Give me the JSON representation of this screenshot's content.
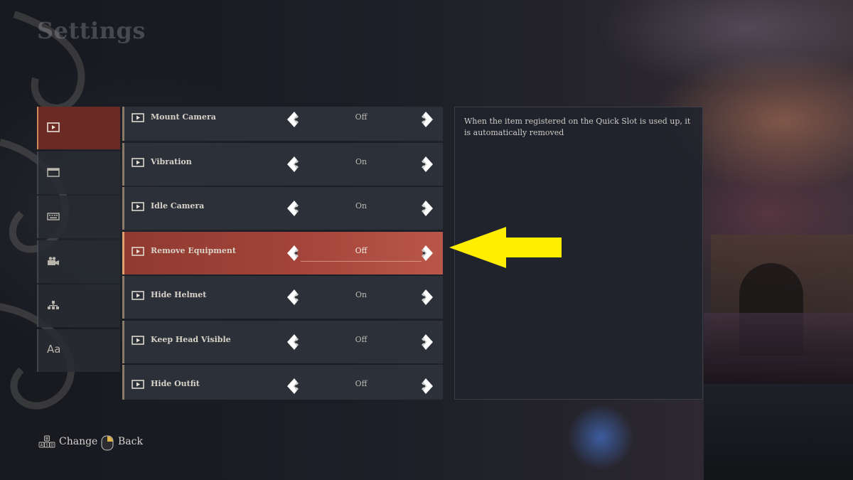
{
  "page": {
    "title": "Settings"
  },
  "tabs": [
    {
      "icon": "play-screen-icon",
      "active": true
    },
    {
      "icon": "window-icon",
      "active": false
    },
    {
      "icon": "keyboard-icon",
      "active": false
    },
    {
      "icon": "video-camera-icon",
      "active": false
    },
    {
      "icon": "network-icon",
      "active": false
    },
    {
      "icon": "text-font-icon",
      "active": false,
      "glyph": "Aa"
    }
  ],
  "settings": [
    {
      "label": "Mount Camera",
      "value": "Off"
    },
    {
      "label": "Vibration",
      "value": "On"
    },
    {
      "label": "Idle Camera",
      "value": "On"
    },
    {
      "label": "Remove Equipment",
      "value": "Off",
      "selected": true
    },
    {
      "label": "Hide Helmet",
      "value": "On"
    },
    {
      "label": "Keep Head Visible",
      "value": "Off"
    },
    {
      "label": "Hide Outfit",
      "value": "Off"
    }
  ],
  "description": "When the item registered on the Quick Slot is used up, it is automatically removed",
  "footer": {
    "change_keys": [
      "W",
      "A",
      "S",
      "D"
    ],
    "change_label": "Change",
    "back_label": "Back"
  },
  "colors": {
    "selected_row": "#a4443a",
    "active_tab": "#6b2a23",
    "annotation_arrow": "#ffee00"
  }
}
